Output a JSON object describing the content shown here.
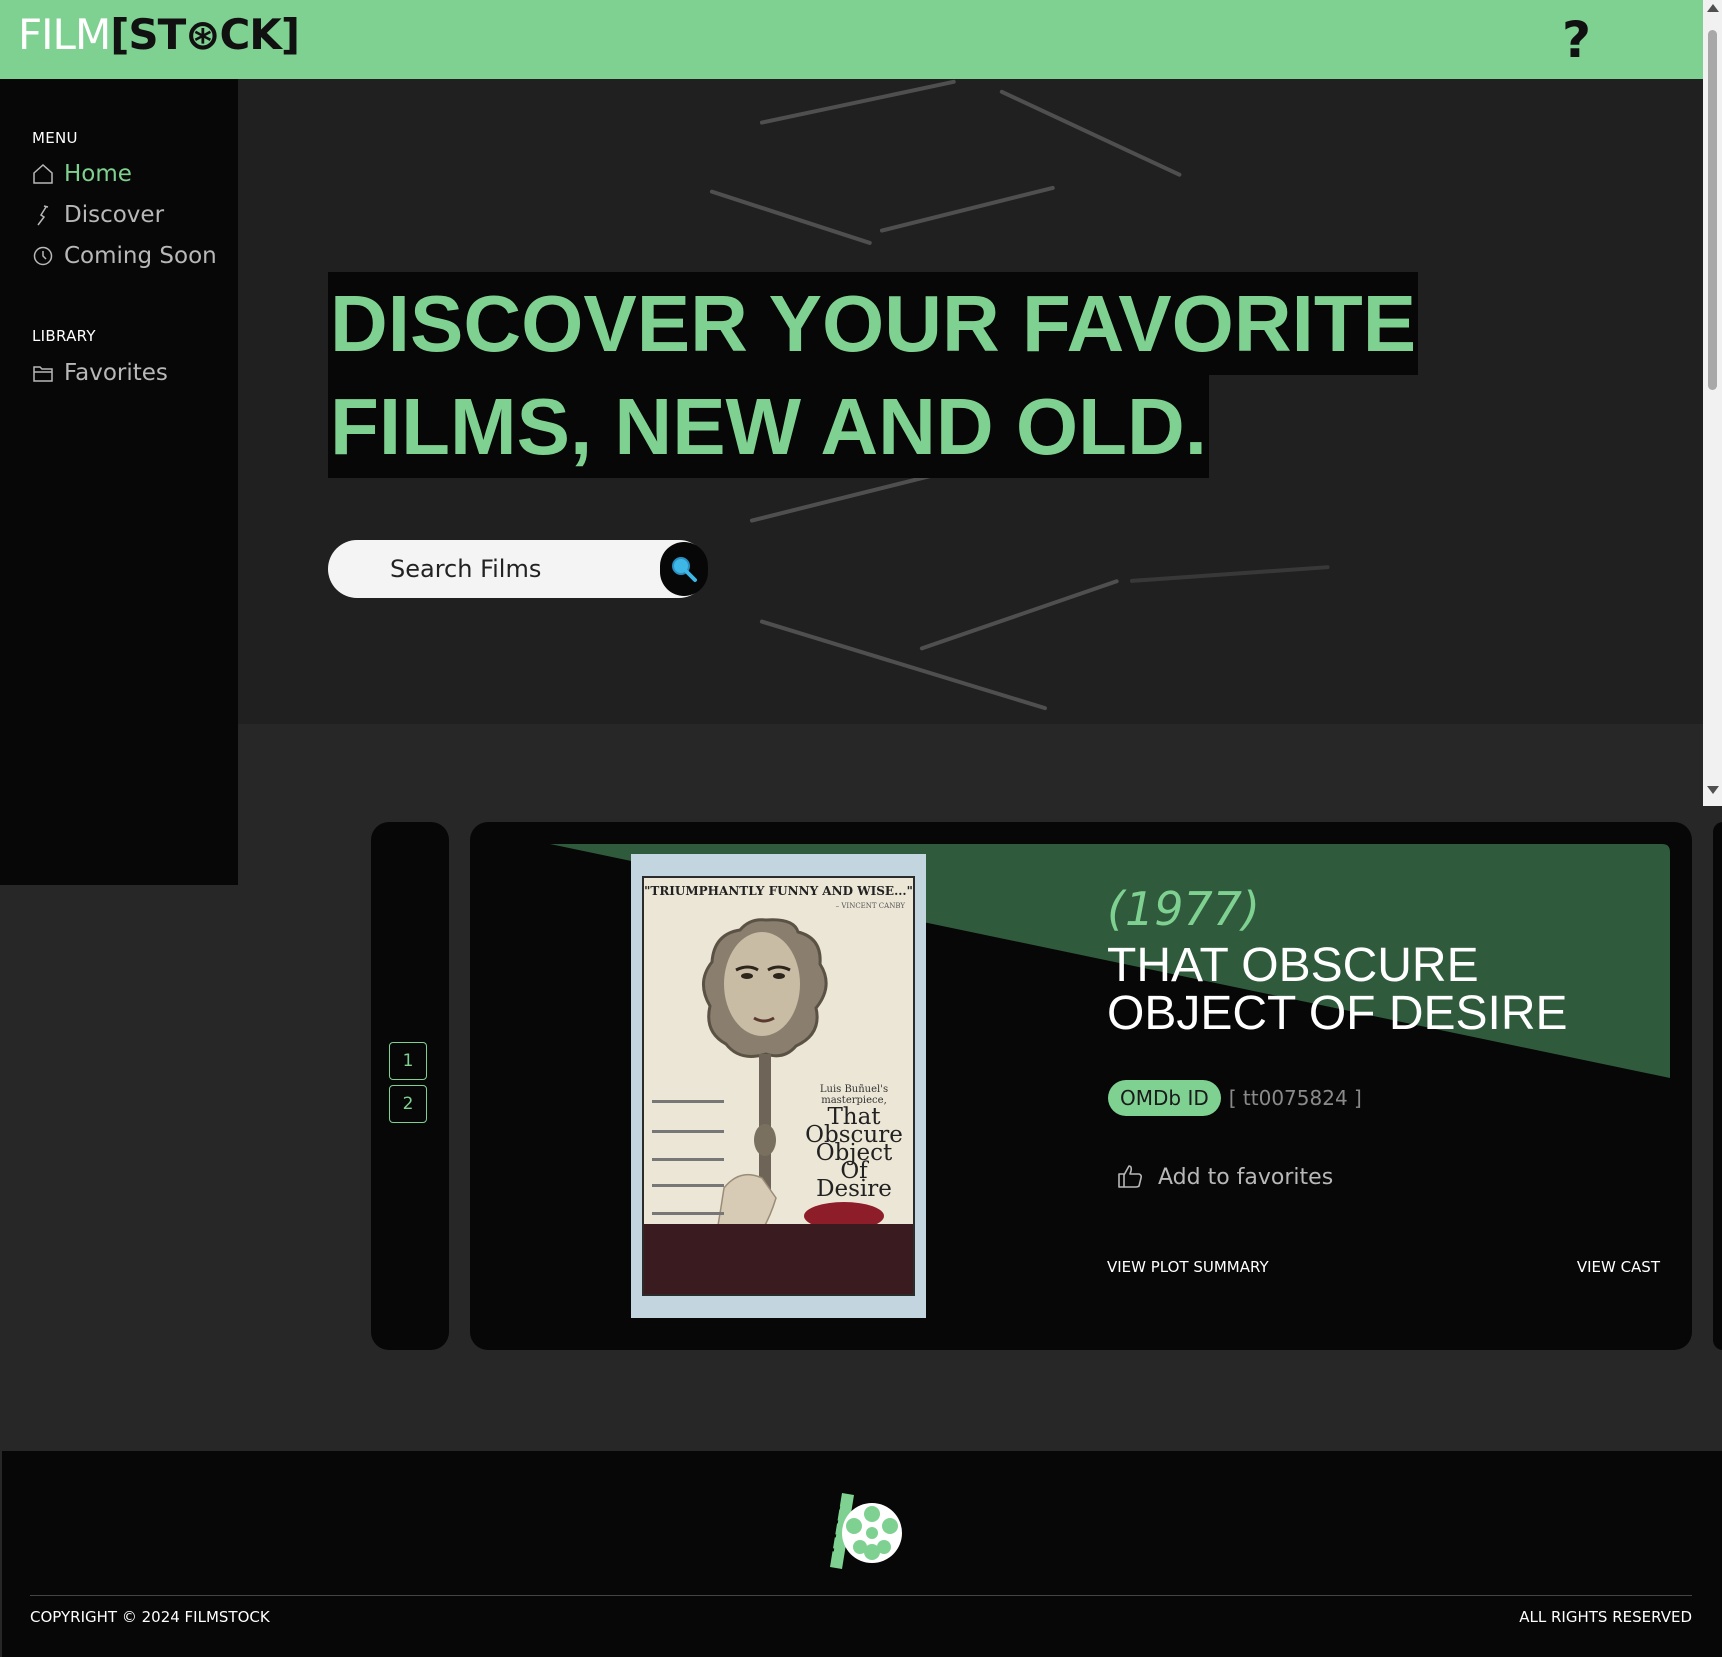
{
  "header": {
    "logo_film": "FILM",
    "logo_stock": "[ST⊛CK]",
    "help_label": "?"
  },
  "sidebar": {
    "menu_title": "MENU",
    "menu_items": [
      {
        "label": "Home",
        "icon": "home-icon",
        "active": true
      },
      {
        "label": "Discover",
        "icon": "discover-icon",
        "active": false
      },
      {
        "label": "Coming Soon",
        "icon": "clock-icon",
        "active": false
      }
    ],
    "library_title": "LIBRARY",
    "library_items": [
      {
        "label": "Favorites",
        "icon": "folder-icon"
      }
    ]
  },
  "hero": {
    "headline_line1": "DISCOVER YOUR FAVORITE",
    "headline_line2": "FILMS, NEW AND OLD.",
    "search_placeholder": "Search Films"
  },
  "pager": {
    "pages": [
      "1",
      "2"
    ]
  },
  "film": {
    "year": "(1977)",
    "title": "THAT OBSCURE OBJECT OF DESIRE",
    "omdb_label": "OMDb ID",
    "omdb_id": "[ tt0075824 ]",
    "favorite_label": "Add to favorites",
    "plot_link": "VIEW PLOT SUMMARY",
    "cast_link": "VIEW CAST",
    "poster": {
      "quote": "\"TRIUMPHANTLY FUNNY AND WISE...\"",
      "quote_author": "– VINCENT CANBY",
      "credit": "Luis Buñuel's masterpiece,",
      "title": "That Obscure Object Of Desire"
    }
  },
  "footer": {
    "copyright": "COPYRIGHT © 2024 FILMSTOCK",
    "rights": "ALL RIGHTS RESERVED"
  },
  "colors": {
    "accent": "#7fd191",
    "header_bg": "#7fd191",
    "dark": "#070707",
    "card_green": "#2f5a3c"
  }
}
